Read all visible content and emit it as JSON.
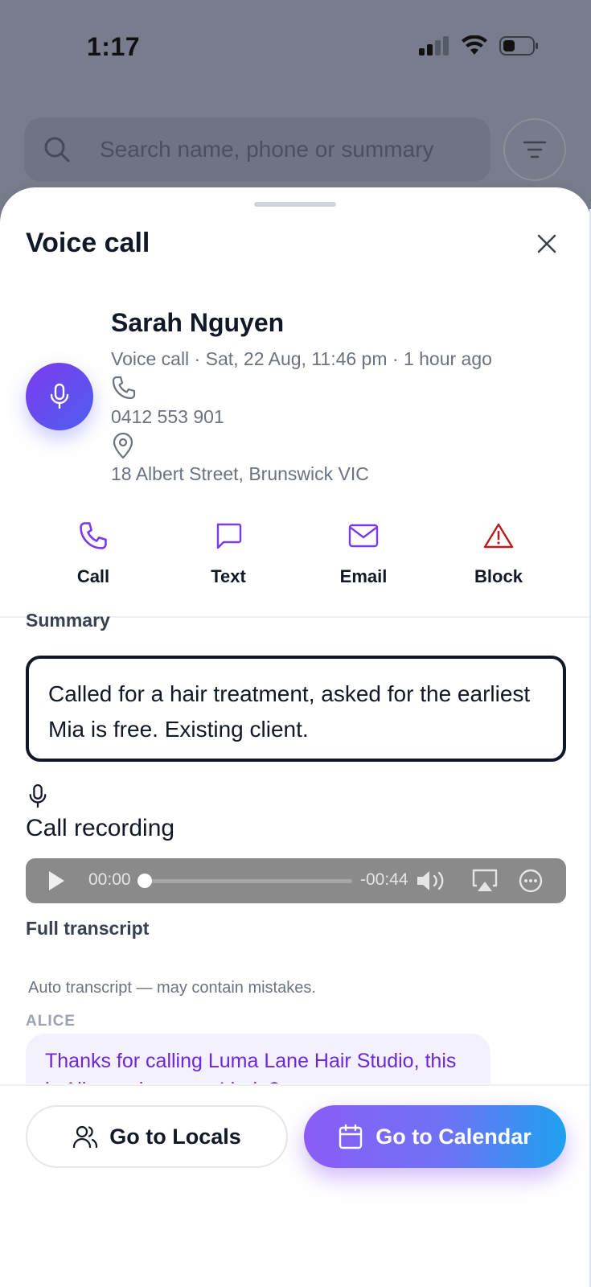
{
  "status_bar": {
    "time": "1:17"
  },
  "background": {
    "search_placeholder": "Search name, phone or summary"
  },
  "sheet": {
    "title": "Voice call",
    "contact": {
      "name": "Sarah Nguyen",
      "meta": "Voice call · Sat, 22 Aug, 11:46 pm · 1 hour ago",
      "phone": "0412 553 901",
      "address": "18 Albert Street, Brunswick VIC"
    },
    "actions": [
      {
        "label": "Call",
        "icon": "phone-icon",
        "color": "#7c3aed"
      },
      {
        "label": "Text",
        "icon": "message-icon",
        "color": "#7c3aed"
      },
      {
        "label": "Email",
        "icon": "mail-icon",
        "color": "#7c3aed"
      },
      {
        "label": "Block",
        "icon": "alert-triangle-icon",
        "color": "#b91c1c"
      }
    ],
    "summary": {
      "label": "Summary",
      "text": "Called for a hair treatment, asked for the earliest Mia is free. Existing client."
    },
    "recording": {
      "label": "Call recording",
      "elapsed": "00:00",
      "remaining": "-00:44",
      "progress": 0
    },
    "transcript": {
      "label": "Full transcript",
      "hint": "Auto transcript — may contain mistakes.",
      "entries": [
        {
          "speaker": "ALICE",
          "text": "Thanks for calling Luma Lane Hair Studio, this is Alice — how can I help?"
        }
      ]
    }
  },
  "footer": {
    "locals_label": "Go to Locals",
    "calendar_label": "Go to Calendar"
  }
}
